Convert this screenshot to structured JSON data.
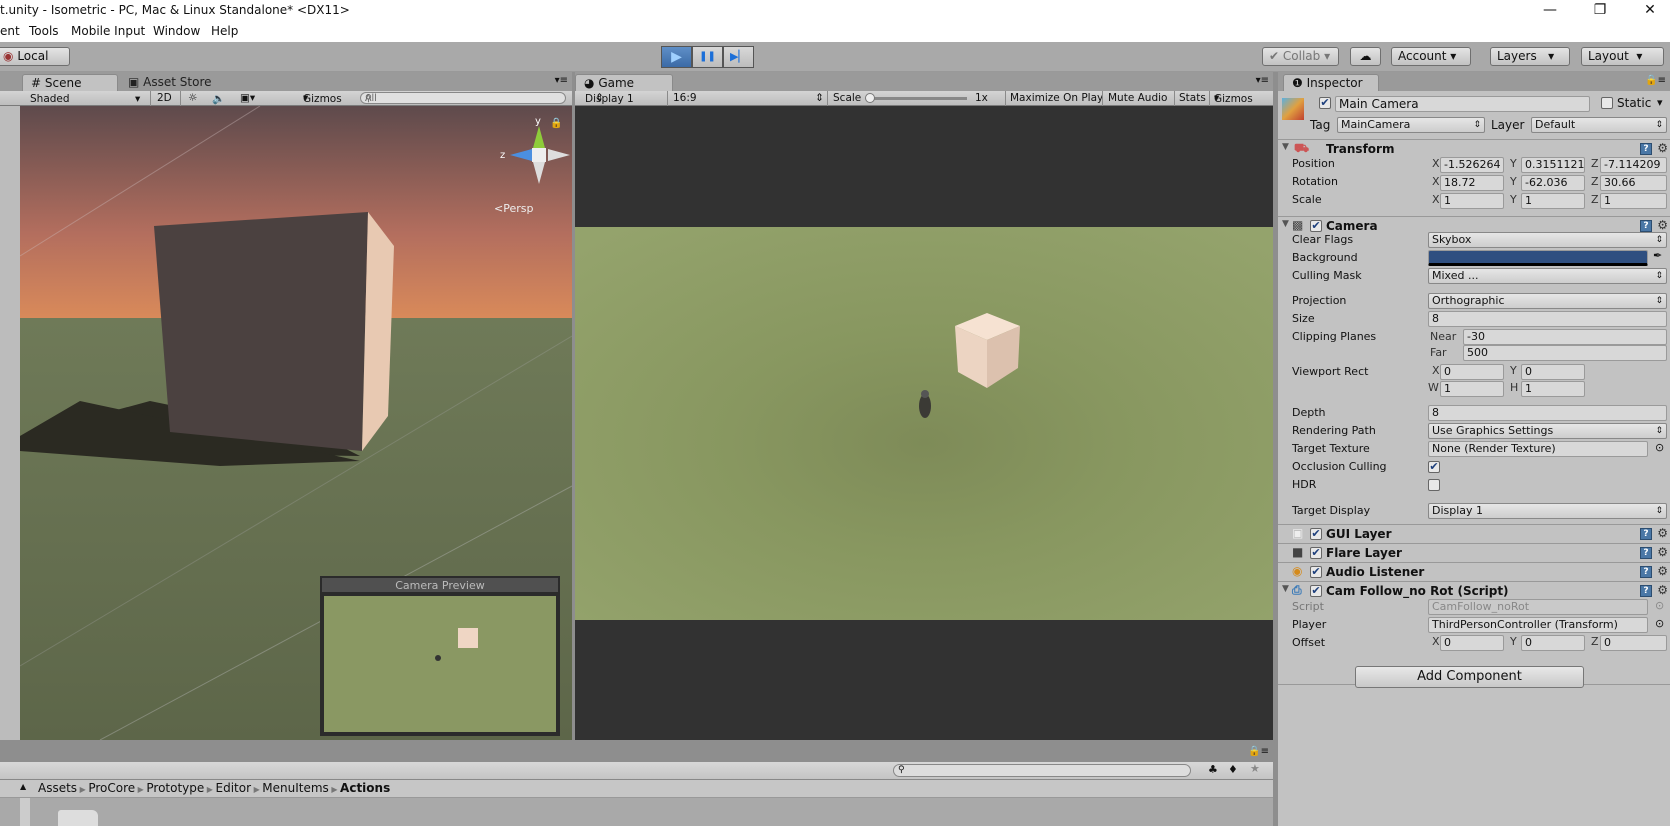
{
  "window": {
    "title": "t.unity - Isometric - PC, Mac & Linux Standalone* <DX11>",
    "minimize": "—",
    "maximize": "❐",
    "close": "✕"
  },
  "menu": [
    "ent",
    "Tools",
    "Mobile Input",
    "Window",
    "Help"
  ],
  "toolbar": {
    "local": "Local",
    "collab": "Collab",
    "account": "Account",
    "layers": "Layers",
    "layout": "Layout",
    "play": "▶",
    "pause": "❚❚",
    "step": "▶▏"
  },
  "scene": {
    "tabs": [
      "Scene",
      "Asset Store"
    ],
    "shading": "Shaded",
    "mode2d": "2D",
    "gizmos": "Gizmos",
    "search_placeholder": "All",
    "persp": "<Persp",
    "gizmo_axes": {
      "y": "y",
      "z": "z"
    },
    "camera_preview": "Camera Preview",
    "colors": {
      "sky_top": "#5e4a4c",
      "sky_horizon": "#d98a5a",
      "ground": "#6c7556"
    }
  },
  "game": {
    "tab": "Game",
    "display": "Display 1",
    "aspect": "16:9",
    "scale_label": "Scale",
    "scale_value": "1x",
    "scale_fraction": 0,
    "buttons": [
      "Maximize On Play",
      "Mute Audio",
      "Stats",
      "Gizmos"
    ],
    "colors": {
      "ground": "#8c9b63",
      "letterbox": "#323232"
    }
  },
  "inspector": {
    "tab": "Inspector",
    "object_name": "Main Camera",
    "active": true,
    "static_label": "Static",
    "tag_label": "Tag",
    "tag": "MainCamera",
    "layer_label": "Layer",
    "layer": "Default",
    "transform": {
      "title": "Transform",
      "position": {
        "label": "Position",
        "x": "-1.526264",
        "y": "0.3151121",
        "z": "-7.114209"
      },
      "rotation": {
        "label": "Rotation",
        "x": "18.72",
        "y": "-62.036",
        "z": "30.66"
      },
      "scale": {
        "label": "Scale",
        "x": "1",
        "y": "1",
        "z": "1"
      }
    },
    "camera": {
      "title": "Camera",
      "clear_flags": {
        "label": "Clear Flags",
        "value": "Skybox"
      },
      "background": {
        "label": "Background",
        "color": "#2f4f80"
      },
      "culling_mask": {
        "label": "Culling Mask",
        "value": "Mixed ..."
      },
      "projection": {
        "label": "Projection",
        "value": "Orthographic"
      },
      "size": {
        "label": "Size",
        "value": "8"
      },
      "clipping": {
        "label": "Clipping Planes",
        "near_label": "Near",
        "near": "-30",
        "far_label": "Far",
        "far": "500"
      },
      "viewport": {
        "label": "Viewport Rect",
        "x": "0",
        "y": "0",
        "w": "1",
        "h": "1"
      },
      "depth": {
        "label": "Depth",
        "value": "8"
      },
      "rendering_path": {
        "label": "Rendering Path",
        "value": "Use Graphics Settings"
      },
      "target_texture": {
        "label": "Target Texture",
        "value": "None (Render Texture)"
      },
      "occlusion_culling": {
        "label": "Occlusion Culling",
        "checked": true
      },
      "hdr": {
        "label": "HDR",
        "checked": false
      },
      "target_display": {
        "label": "Target Display",
        "value": "Display 1"
      }
    },
    "components": [
      "GUI Layer",
      "Flare Layer",
      "Audio Listener"
    ],
    "script": {
      "title": "Cam Follow_no Rot (Script)",
      "script_label": "Script",
      "script": "CamFollow_noRot",
      "player_label": "Player",
      "player": "ThirdPersonController (Transform)",
      "offset_label": "Offset",
      "x": "0",
      "y": "0",
      "z": "0"
    },
    "add_component": "Add Component"
  },
  "project": {
    "breadcrumb": [
      "Assets",
      "ProCore",
      "Prototype",
      "Editor",
      "MenuItems",
      "Actions"
    ]
  }
}
